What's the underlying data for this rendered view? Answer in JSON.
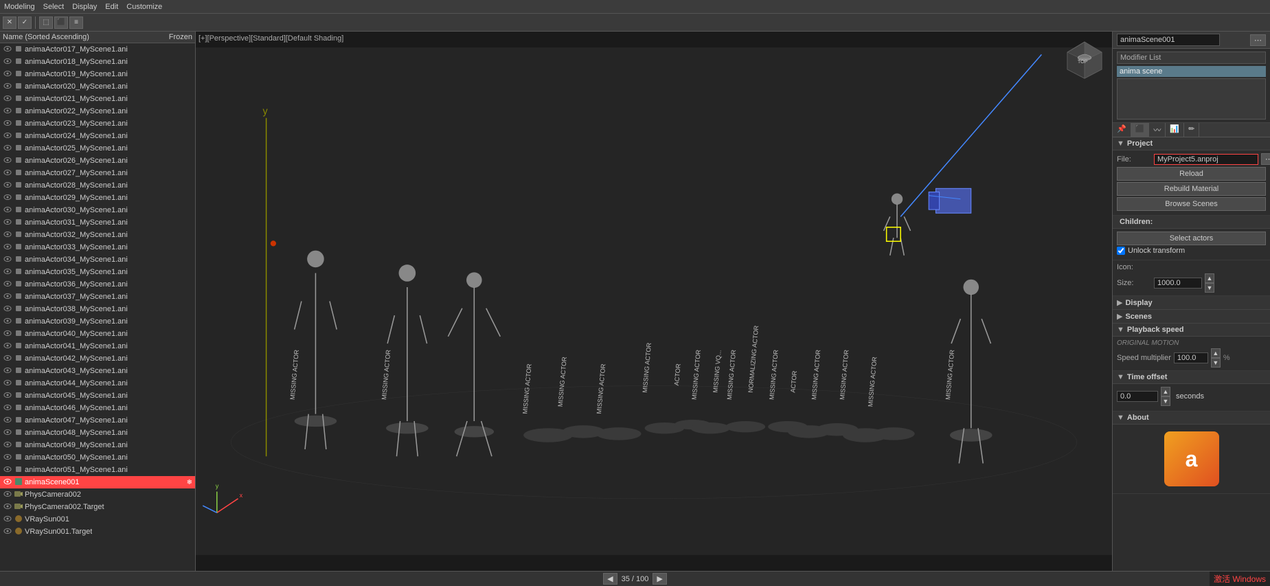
{
  "app": {
    "title": "Modeling",
    "menu": [
      "Select",
      "Display",
      "Edit",
      "Customize"
    ]
  },
  "toolbar": {
    "buttons": [
      "✕",
      "✓",
      "⬚",
      "⬛",
      "≡"
    ]
  },
  "left_panel": {
    "header": {
      "name_col": "Name (Sorted Ascending)",
      "frozen_col": "Frozen"
    },
    "items": [
      {
        "label": "animaActor017_MyScene1.ani",
        "selected": false
      },
      {
        "label": "animaActor018_MyScene1.ani",
        "selected": false
      },
      {
        "label": "animaActor019_MyScene1.ani",
        "selected": false
      },
      {
        "label": "animaActor020_MyScene1.ani",
        "selected": false
      },
      {
        "label": "animaActor021_MyScene1.ani",
        "selected": false
      },
      {
        "label": "animaActor022_MyScene1.ani",
        "selected": false
      },
      {
        "label": "animaActor023_MyScene1.ani",
        "selected": false
      },
      {
        "label": "animaActor024_MyScene1.ani",
        "selected": false
      },
      {
        "label": "animaActor025_MyScene1.ani",
        "selected": false
      },
      {
        "label": "animaActor026_MyScene1.ani",
        "selected": false
      },
      {
        "label": "animaActor027_MyScene1.ani",
        "selected": false
      },
      {
        "label": "animaActor028_MyScene1.ani",
        "selected": false
      },
      {
        "label": "animaActor029_MyScene1.ani",
        "selected": false
      },
      {
        "label": "animaActor030_MyScene1.ani",
        "selected": false
      },
      {
        "label": "animaActor031_MyScene1.ani",
        "selected": false
      },
      {
        "label": "animaActor032_MyScene1.ani",
        "selected": false
      },
      {
        "label": "animaActor033_MyScene1.ani",
        "selected": false
      },
      {
        "label": "animaActor034_MyScene1.ani",
        "selected": false
      },
      {
        "label": "animaActor035_MyScene1.ani",
        "selected": false
      },
      {
        "label": "animaActor036_MyScene1.ani",
        "selected": false
      },
      {
        "label": "animaActor037_MyScene1.ani",
        "selected": false
      },
      {
        "label": "animaActor038_MyScene1.ani",
        "selected": false
      },
      {
        "label": "animaActor039_MyScene1.ani",
        "selected": false
      },
      {
        "label": "animaActor040_MyScene1.ani",
        "selected": false
      },
      {
        "label": "animaActor041_MyScene1.ani",
        "selected": false
      },
      {
        "label": "animaActor042_MyScene1.ani",
        "selected": false
      },
      {
        "label": "animaActor043_MyScene1.ani",
        "selected": false
      },
      {
        "label": "animaActor044_MyScene1.ani",
        "selected": false
      },
      {
        "label": "animaActor045_MyScene1.ani",
        "selected": false
      },
      {
        "label": "animaActor046_MyScene1.ani",
        "selected": false
      },
      {
        "label": "animaActor047_MyScene1.ani",
        "selected": false
      },
      {
        "label": "animaActor048_MyScene1.ani",
        "selected": false
      },
      {
        "label": "animaActor049_MyScene1.ani",
        "selected": false
      },
      {
        "label": "animaActor050_MyScene1.ani",
        "selected": false
      },
      {
        "label": "animaActor051_MyScene1.ani",
        "selected": false
      },
      {
        "label": "animaScene001",
        "selected": true
      },
      {
        "label": "PhysCamera002",
        "selected": false
      },
      {
        "label": "PhysCamera002.Target",
        "selected": false
      },
      {
        "label": "VRaySun001",
        "selected": false
      },
      {
        "label": "VRaySun001.Target",
        "selected": false
      }
    ]
  },
  "viewport": {
    "label": "[+][Perspective][Standard][Default Shading]",
    "status": "35 / 100",
    "y_axis_label": "y",
    "coord_label": "y"
  },
  "right_panel": {
    "object_name": "animaScene001",
    "modifier_list_label": "Modifier List",
    "modifier_name": "anima scene",
    "tabs": [
      "pin",
      "cube",
      "modifier",
      "graph",
      "edit"
    ],
    "project_section": {
      "title": "Project",
      "file_label": "File:",
      "file_value": "MyProject5.anproj",
      "reload_btn": "Reload",
      "rebuild_material_btn": "Rebuild Material",
      "browse_scenes_btn": "Browse Scenes"
    },
    "children_section": {
      "title": "Children:",
      "select_actors_btn": "Select actors",
      "unlock_transform_label": "Unlock transform",
      "unlock_transform_checked": true
    },
    "icon_section": {
      "title": "Icon:",
      "size_label": "Size:",
      "size_value": "1000.0"
    },
    "display_section": {
      "title": "Display"
    },
    "scenes_section": {
      "title": "Scenes"
    },
    "playback_section": {
      "title": "Playback speed",
      "original_motion_label": "ORIGINAL MOTION",
      "speed_label": "Speed multiplier",
      "speed_value": "100.0",
      "pct": "%"
    },
    "time_offset_section": {
      "title": "Time offset",
      "value": "0.0",
      "unit": "seconds"
    },
    "about_section": {
      "title": "About",
      "logo_letter": "a"
    }
  },
  "status_bar": {
    "prev_btn": "◀",
    "next_btn": "▶",
    "current": "35 / 100"
  },
  "watermark": "激活 Windows"
}
